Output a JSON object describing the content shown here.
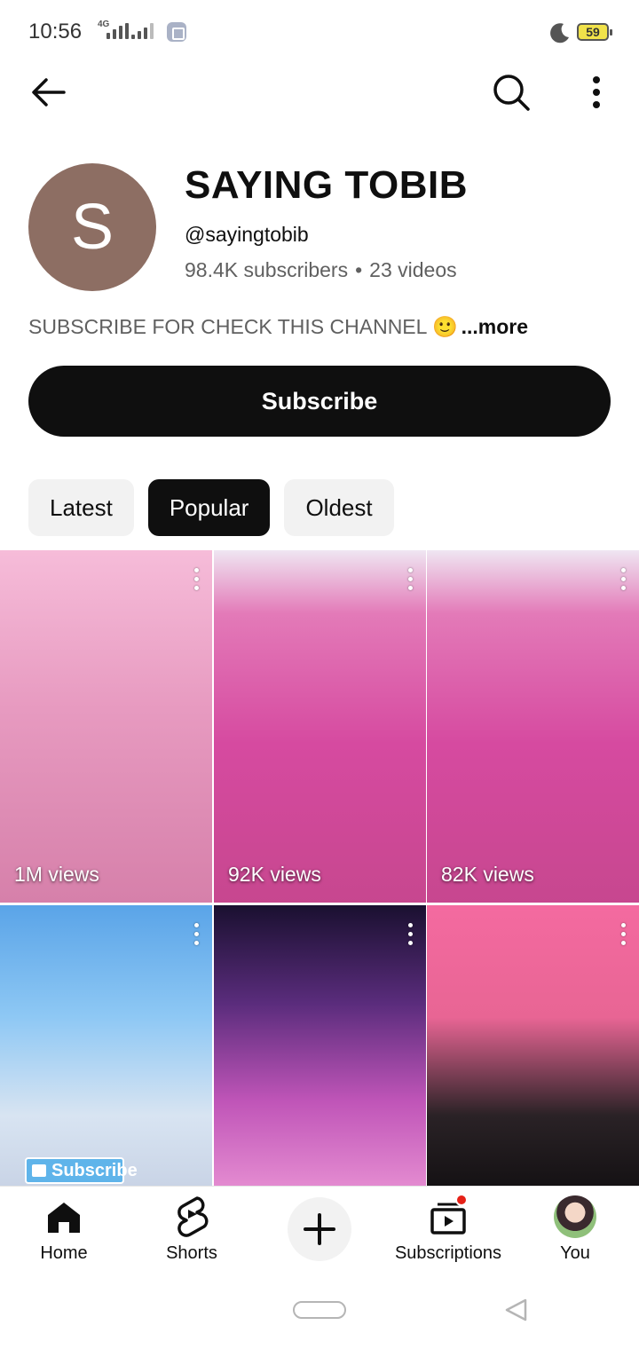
{
  "status_bar": {
    "time": "10:56",
    "network": "4G",
    "battery": "59"
  },
  "top_bar": {
    "back_icon": "arrow-left-icon",
    "search_icon": "search-icon",
    "more_icon": "more-vert-icon"
  },
  "channel": {
    "avatar_letter": "S",
    "avatar_color": "#8d6e63",
    "name": "SAYING TOBIB",
    "handle": "@sayingtobib",
    "subscribers": "98.4K subscribers",
    "separator": "•",
    "videos": "23 videos",
    "description": "SUBSCRIBE FOR CHECK THIS CHANNEL 🙂",
    "more_label": "...more",
    "subscribe_label": "Subscribe"
  },
  "chips": [
    {
      "label": "Latest",
      "active": false
    },
    {
      "label": "Popular",
      "active": true
    },
    {
      "label": "Oldest",
      "active": false
    }
  ],
  "shorts": [
    {
      "views": "1M views"
    },
    {
      "views": "92K views"
    },
    {
      "views": "82K views"
    },
    {
      "views": "",
      "sticker": "Subscribe"
    },
    {
      "views": ""
    },
    {
      "views": ""
    }
  ],
  "bottom_nav": {
    "home": "Home",
    "shorts": "Shorts",
    "subscriptions": "Subscriptions",
    "you": "You"
  },
  "colors": {
    "accent_dark": "#0f0f0f",
    "chip_bg": "#f2f2f2",
    "notification": "#e62117"
  }
}
